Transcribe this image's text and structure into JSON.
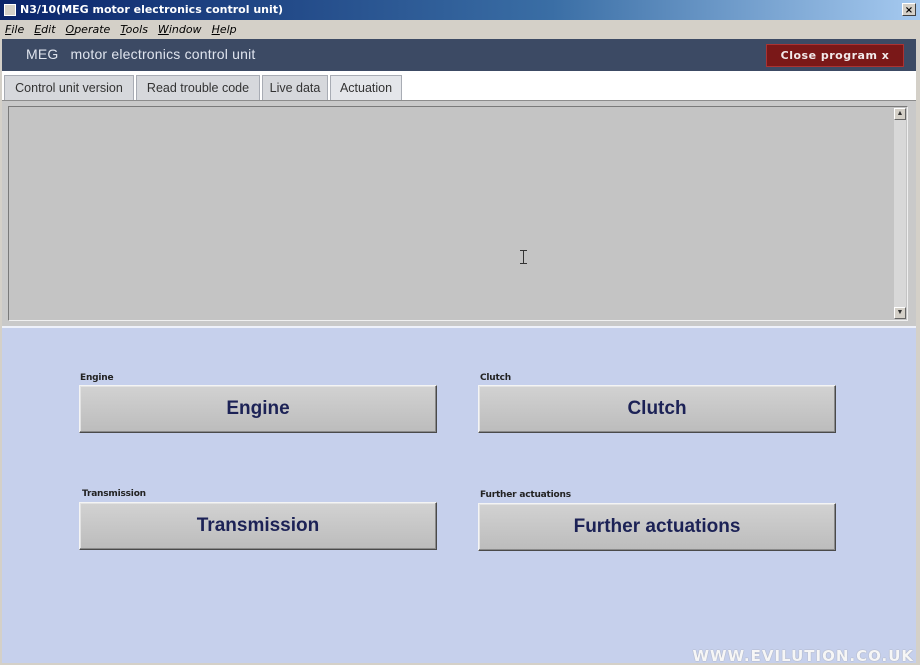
{
  "window": {
    "title": "N3/10(MEG motor electronics control unit)",
    "close_glyph": "×"
  },
  "menu": {
    "items": [
      {
        "mnemonic": "F",
        "rest": "ile"
      },
      {
        "mnemonic": "E",
        "rest": "dit"
      },
      {
        "mnemonic": "O",
        "rest": "perate"
      },
      {
        "mnemonic": "T",
        "rest": "ools"
      },
      {
        "mnemonic": "W",
        "rest": "indow"
      },
      {
        "mnemonic": "H",
        "rest": "elp"
      }
    ]
  },
  "header": {
    "abbr": "MEG",
    "title": "motor electronics control unit",
    "close_label": "Close program x"
  },
  "tabs": [
    {
      "label": "Control unit version"
    },
    {
      "label": "Read trouble code"
    },
    {
      "label": "Live data"
    },
    {
      "label": "Actuation",
      "active": true
    }
  ],
  "actuation": {
    "engine": {
      "group_label": "Engine",
      "button_label": "Engine"
    },
    "clutch": {
      "group_label": "Clutch",
      "button_label": "Clutch"
    },
    "transmission": {
      "group_label": "Transmission",
      "button_label": "Transmission"
    },
    "further": {
      "group_label": "Further actuations",
      "button_label": "Further actuations"
    }
  },
  "watermark": "WWW.EVILUTION.CO.UK",
  "colors": {
    "header_bg": "#3c4a64",
    "close_button_bg": "#7a1818",
    "actuation_panel_bg": "#c6d0ec",
    "button_text": "#1c2256"
  }
}
